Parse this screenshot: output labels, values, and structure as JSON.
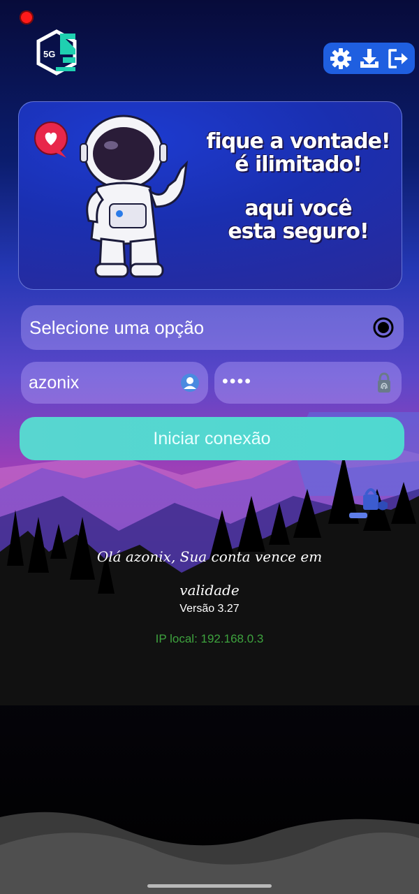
{
  "app": {
    "logo": {
      "text": "5G",
      "icon": "5g-hex-logo"
    },
    "toolbar": {
      "settings_icon": "gear-icon",
      "download_icon": "download-icon",
      "logout_icon": "logout-icon"
    }
  },
  "banner": {
    "line1": "fique a vontade!",
    "line2": "é ilimitado!",
    "line3": "aqui você",
    "line4": "esta seguro!"
  },
  "form": {
    "select_label": "Selecione uma opção",
    "username_value": "azonix",
    "password_value": "••••",
    "connect_label": "Iniciar conexão"
  },
  "status": {
    "message_line1": "Olá azonix, Sua conta vence em",
    "message_line2": "validade",
    "version": "Versão 3.27",
    "ip": "IP local: 192.168.0.3"
  },
  "colors": {
    "toolbar": "#1f5fe0",
    "accent": "#4fd8d0",
    "ip_text": "#3ea33e",
    "record_dot": "#ff1a1a"
  }
}
